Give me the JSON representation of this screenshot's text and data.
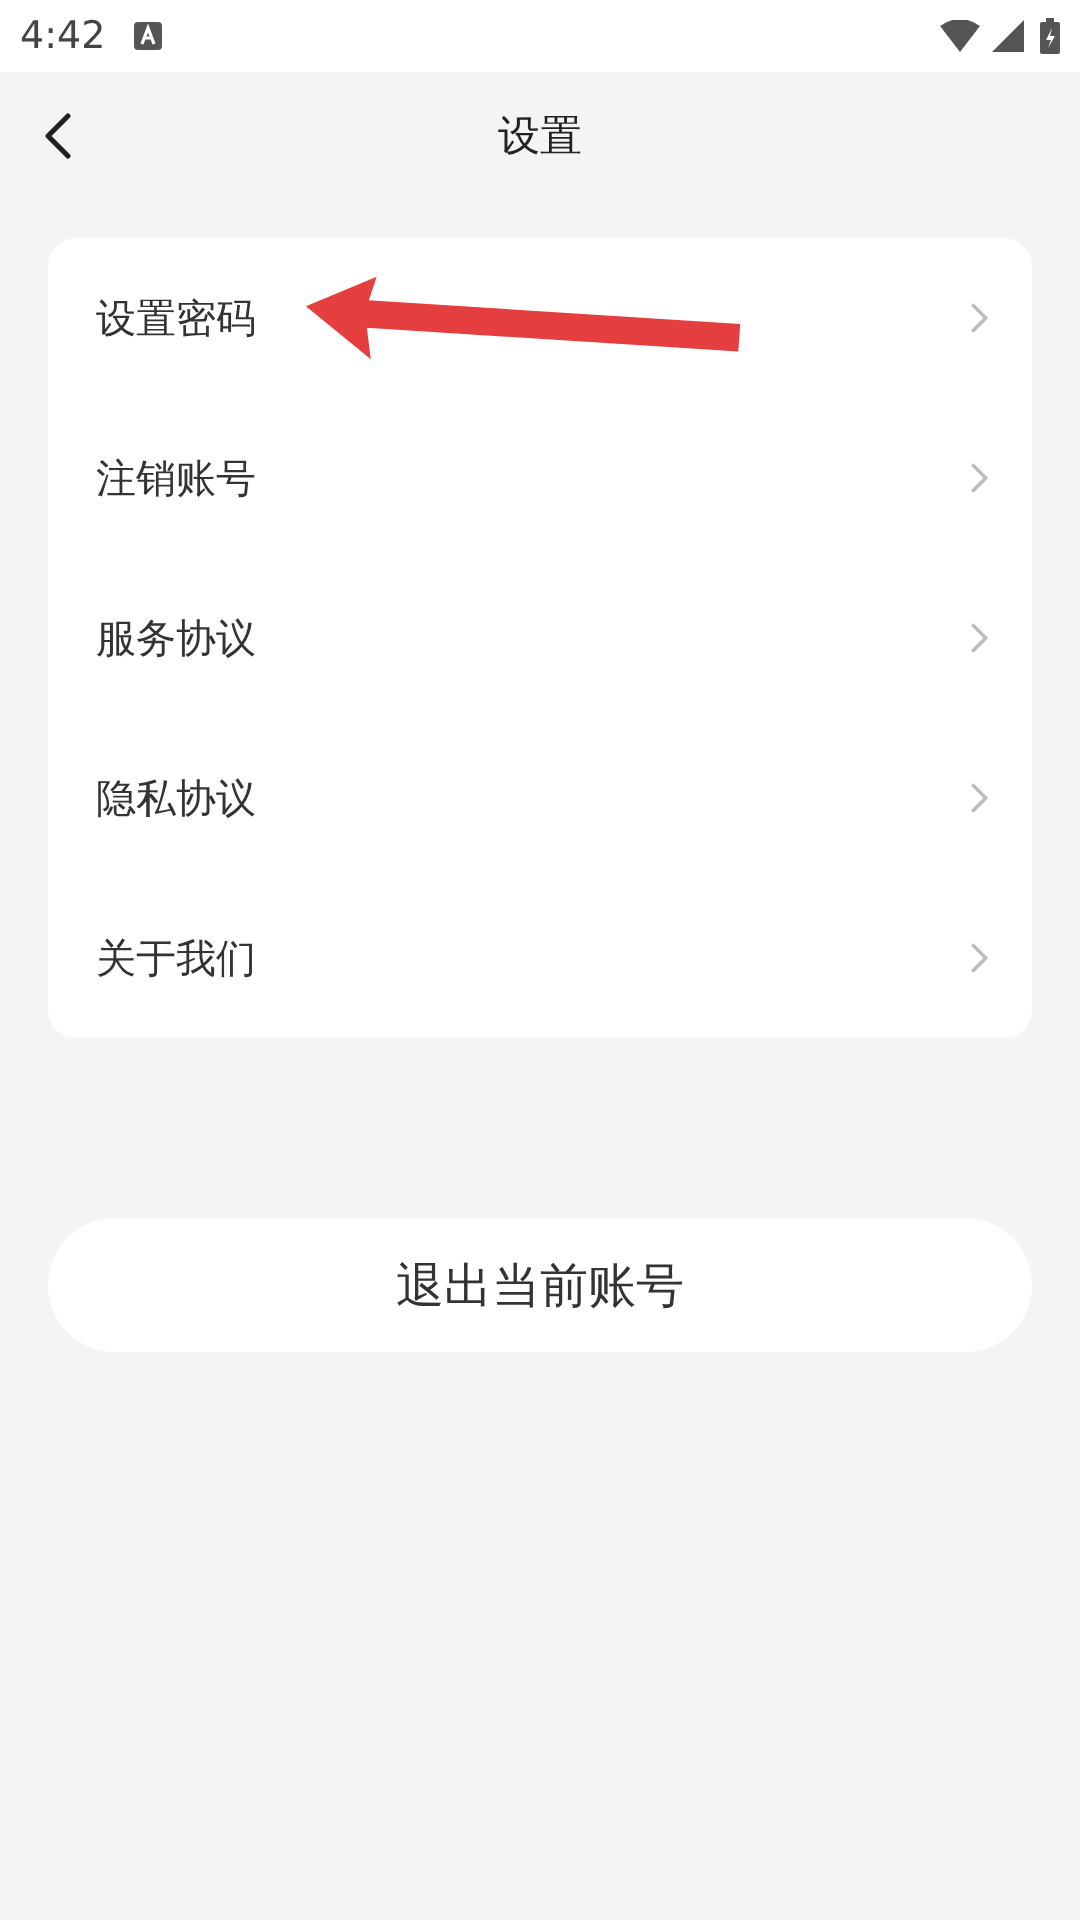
{
  "status_bar": {
    "time": "4:42"
  },
  "header": {
    "title": "设置"
  },
  "menu": [
    {
      "label": "设置密码"
    },
    {
      "label": "注销账号"
    },
    {
      "label": "服务协议"
    },
    {
      "label": "隐私协议"
    },
    {
      "label": "关于我们"
    }
  ],
  "logout_button": {
    "label": "退出当前账号"
  }
}
